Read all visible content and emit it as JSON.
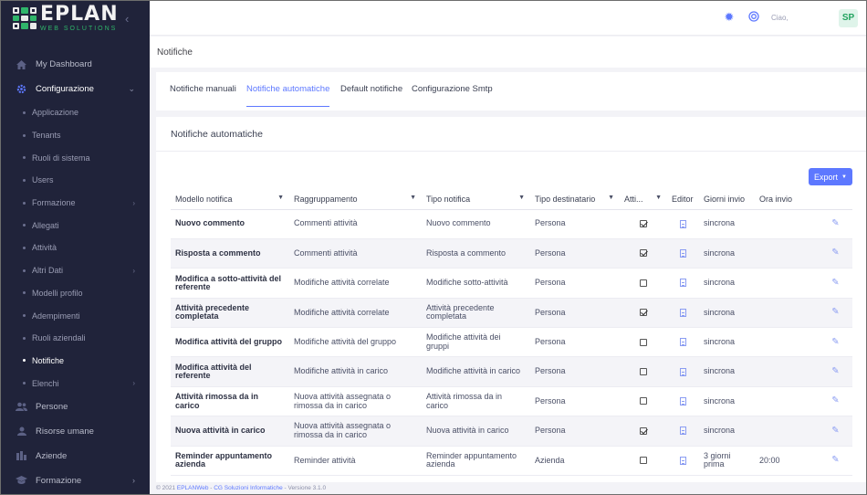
{
  "brand": {
    "name": "EPLAN",
    "sub": "WEB SOLUTIONS"
  },
  "nav": {
    "dashboard": "My Dashboard",
    "configurazione": "Configurazione",
    "sub": [
      "Applicazione",
      "Tenants",
      "Ruoli di sistema",
      "Users",
      "Formazione",
      "Allegati",
      "Attività",
      "Altri Dati",
      "Modelli profilo",
      "Adempimenti",
      "Ruoli aziendali",
      "Notifiche",
      "Elenchi"
    ],
    "persone": "Persone",
    "risorse": "Risorse umane",
    "aziende": "Aziende",
    "formazione": "Formazione"
  },
  "topbar": {
    "hello": "Ciao,",
    "avatar": "SP"
  },
  "page": {
    "title": "Notifiche"
  },
  "tabs": [
    "Notifiche manuali",
    "Notifiche automatiche",
    "Default notifiche",
    "Configurazione Smtp"
  ],
  "card": {
    "title": "Notifiche automatiche",
    "export": "Export"
  },
  "table": {
    "headers": [
      "Modello notifica",
      "Raggruppamento",
      "Tipo notifica",
      "Tipo destinatario",
      "Atti...",
      "Editor",
      "Giorni invio",
      "Ora invio"
    ],
    "rows": [
      {
        "modello": "Nuovo commento",
        "gruppo": "Commenti attività",
        "tipo": "Nuovo commento",
        "dest": "Persona",
        "attiva": true,
        "giorni": "sincrona",
        "ora": ""
      },
      {
        "modello": "Risposta a commento",
        "gruppo": "Commenti attività",
        "tipo": "Risposta a commento",
        "dest": "Persona",
        "attiva": true,
        "giorni": "sincrona",
        "ora": ""
      },
      {
        "modello": "Modifica a sotto-attività del referente",
        "gruppo": "Modifiche attività correlate",
        "tipo": "Modifiche sotto-attività",
        "dest": "Persona",
        "attiva": false,
        "giorni": "sincrona",
        "ora": ""
      },
      {
        "modello": "Attività precedente completata",
        "gruppo": "Modifiche attività correlate",
        "tipo": "Attività precedente completata",
        "dest": "Persona",
        "attiva": true,
        "giorni": "sincrona",
        "ora": ""
      },
      {
        "modello": "Modifica attività del gruppo",
        "gruppo": "Modifiche attività del gruppo",
        "tipo": "Modifiche attività dei gruppi",
        "dest": "Persona",
        "attiva": false,
        "giorni": "sincrona",
        "ora": ""
      },
      {
        "modello": "Modifica attività del referente",
        "gruppo": "Modifiche attività in carico",
        "tipo": "Modifiche attività in carico",
        "dest": "Persona",
        "attiva": false,
        "giorni": "sincrona",
        "ora": ""
      },
      {
        "modello": "Attività rimossa da in carico",
        "gruppo": "Nuova attività assegnata o rimossa da in carico",
        "tipo": "Attività rimossa da in carico",
        "dest": "Persona",
        "attiva": false,
        "giorni": "sincrona",
        "ora": ""
      },
      {
        "modello": "Nuova attività in carico",
        "gruppo": "Nuova attività assegnata o rimossa da in carico",
        "tipo": "Nuova attività in carico",
        "dest": "Persona",
        "attiva": true,
        "giorni": "sincrona",
        "ora": ""
      },
      {
        "modello": "Reminder appuntamento azienda",
        "gruppo": "Reminder attività",
        "tipo": "Reminder appuntamento azienda",
        "dest": "Azienda",
        "attiva": false,
        "giorni": "3 giorni prima",
        "ora": "20:00"
      }
    ]
  },
  "footer": {
    "prefix": "© 2021 ",
    "link1": "EPLANWeb",
    "sep": " - ",
    "link2": "CG Soluzioni Informatiche",
    "suffix": " - Versione 3.1.0"
  },
  "colors": {
    "accent": "#5d78ff",
    "sidebar": "#20233a",
    "brand_green": "#2fb56a"
  }
}
